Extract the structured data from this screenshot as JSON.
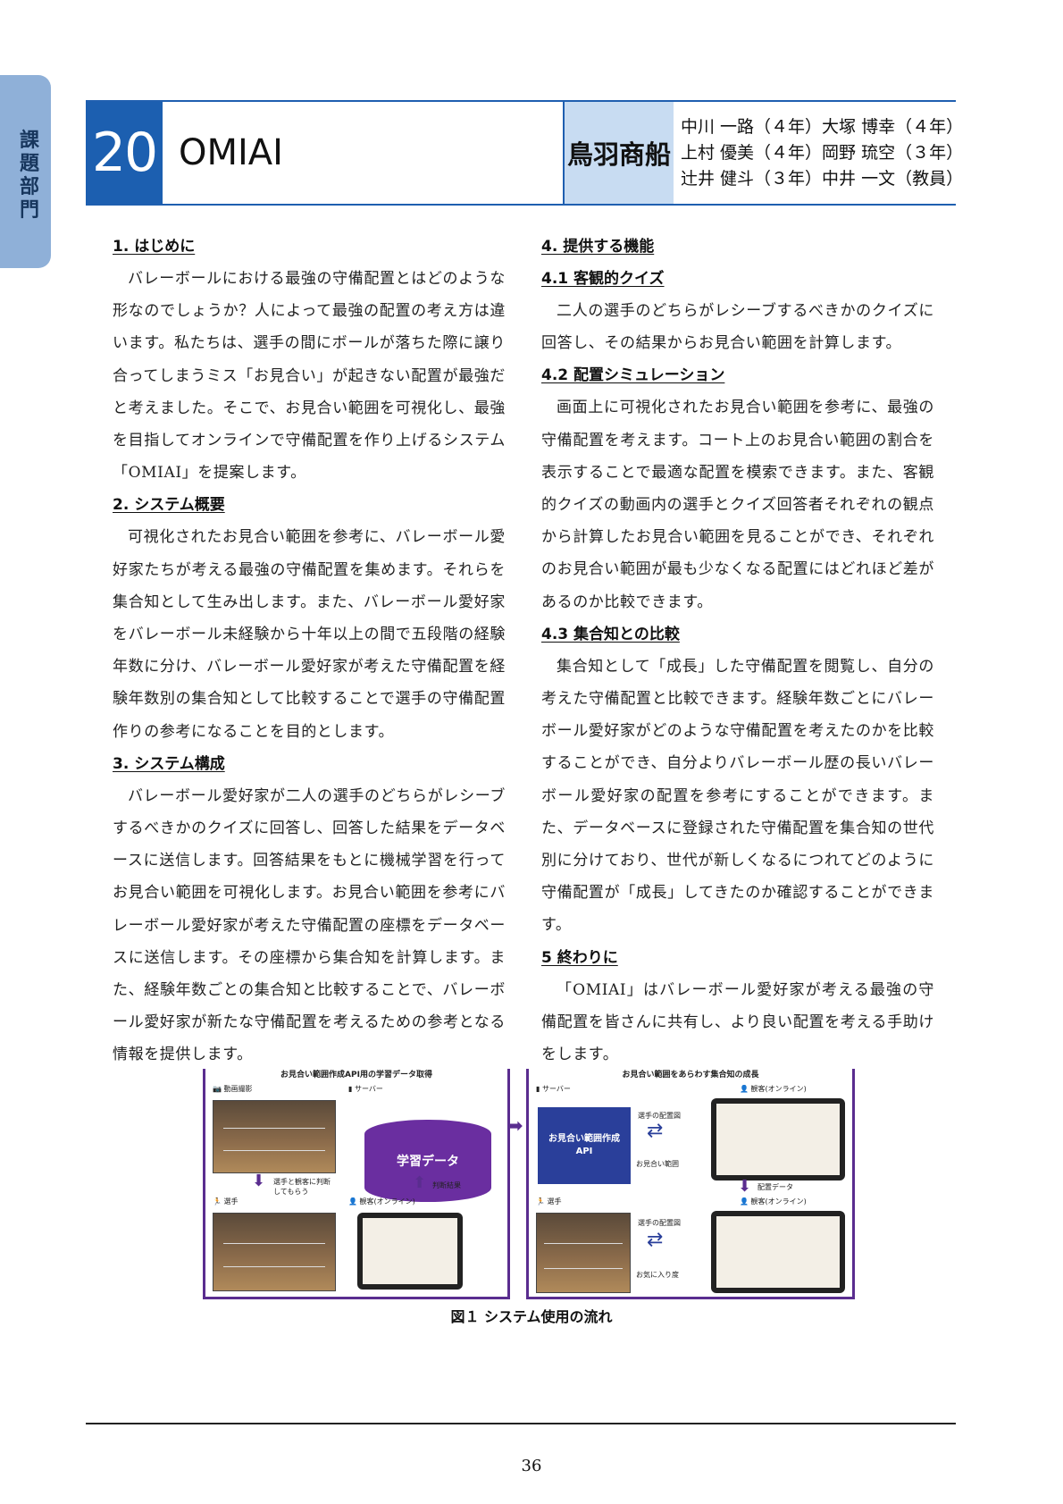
{
  "side_tab": {
    "label": "課題部門"
  },
  "header": {
    "number": "20",
    "title": "OMIAI",
    "school": "鳥羽商船",
    "members": [
      "中川 一路（４年）大塚 博幸（４年）",
      "上村 優美（４年）岡野 琉空（３年）",
      "辻井 健斗（３年）中井 一文（教員）"
    ]
  },
  "left_column": {
    "s1_title": "1. はじめに",
    "s1_body": "バレーボールにおける最強の守備配置とはどのような形なのでしょうか？人によって最強の配置の考え方は違います。私たちは、選手の間にボールが落ちた際に譲り合ってしまうミス「お見合い」が起きない配置が最強だと考えました。そこで、お見合い範囲を可視化し、最強を目指してオンラインで守備配置を作り上げるシステム「OMIAI」を提案します。",
    "s2_title": "2. システム概要",
    "s2_body": "可視化されたお見合い範囲を参考に、バレーボール愛好家たちが考える最強の守備配置を集めます。それらを集合知として生み出します。また、バレーボール愛好家をバレーボール未経験から十年以上の間で五段階の経験年数に分け、バレーボール愛好家が考えた守備配置を経験年数別の集合知として比較することで選手の守備配置作りの参考になることを目的とします。",
    "s3_title": "3. システム構成",
    "s3_body": "バレーボール愛好家が二人の選手のどちらがレシーブするべきかのクイズに回答し、回答した結果をデータベースに送信します。回答結果をもとに機械学習を行ってお見合い範囲を可視化します。お見合い範囲を参考にバレーボール愛好家が考えた守備配置の座標をデータベースに送信します。その座標から集合知を計算します。また、経験年数ごとの集合知と比較することで、バレーボール愛好家が新たな守備配置を考えるための参考となる情報を提供します。"
  },
  "right_column": {
    "s4_title": "4. 提供する機能",
    "s41_title": "4.1 客観的クイズ",
    "s41_body": "二人の選手のどちらがレシーブするべきかのクイズに回答し、その結果からお見合い範囲を計算します。",
    "s42_title": "4.2 配置シミュレーション",
    "s42_body": "画面上に可視化されたお見合い範囲を参考に、最強の守備配置を考えます。コート上のお見合い範囲の割合を表示することで最適な配置を模索できます。また、客観的クイズの動画内の選手とクイズ回答者それぞれの観点から計算したお見合い範囲を見ることができ、それぞれのお見合い範囲が最も少なくなる配置にはどれほど差があるのか比較できます。",
    "s43_title": "4.3 集合知との比較",
    "s43_body": "集合知として「成長」した守備配置を閲覧し、自分の考えた守備配置と比較できます。経験年数ごとにバレーボール愛好家がどのような守備配置を考えたのかを比較することができ、自分よりバレーボール歴の長いバレーボール愛好家の配置を参考にすることができます。また、データベースに登録された守備配置を集合知の世代別に分けており、世代が新しくなるにつれてどのように守備配置が「成長」してきたのか確認することができます。",
    "s5_title": "5 終わりに",
    "s5_body": "「OMIAI」はバレーボール愛好家が考える最強の守備配置を皆さんに共有し、より良い配置を考える手助けをします。"
  },
  "figure": {
    "left_panel_title": "お見合い範囲作成API用の学習データ取得",
    "right_panel_title": "お見合い範囲をあらわす集合知の成長",
    "video_label": "動画撮影",
    "server_label": "サーバー",
    "db_label": "学習データ",
    "player_label": "選手",
    "viewer_label": "観客(オンライン)",
    "judge_label": "判断結果",
    "note_label": "選手と観客に判断してもらう",
    "api_label": "お見合い範囲作成",
    "api_sub": "API",
    "player_pos": "選手の配置図",
    "omiai_range": "お見合い範囲",
    "placement_data": "配置データ",
    "favorite": "お気に入り度",
    "caption": "図１ システム使用の流れ",
    "colors": {
      "frame": "#5a2d8f",
      "db": "#6a2ea0",
      "api": "#2a3f9a"
    }
  },
  "footer": {
    "page_number": "36"
  }
}
